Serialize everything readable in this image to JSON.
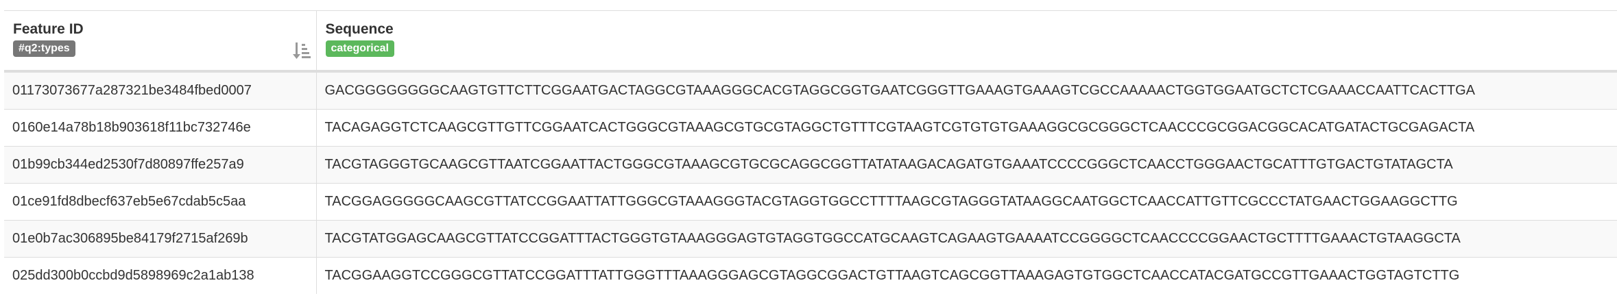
{
  "table": {
    "columns": [
      {
        "title": "Feature ID",
        "badge": "#q2:types",
        "badge_color": "#777777"
      },
      {
        "title": "Sequence",
        "badge": "categorical",
        "badge_color": "#5cb85c"
      }
    ],
    "sort_icon": "sort-amount-down-icon",
    "rows": [
      {
        "feature_id": "01173073677a287321be3484fbed0007",
        "sequence": "GACGGGGGGGGCAAGTGTTCTTCGGAATGACTAGGCGTAAAGGGCACGTAGGCGGTGAATCGGGTTGAAAGTGAAAGTCGCCAAAAACTGGTGGAATGCTCTCGAAACCAATTCACTTGA"
      },
      {
        "feature_id": "0160e14a78b18b903618f11bc732746e",
        "sequence": "TACAGAGGTCTCAAGCGTTGTTCGGAATCACTGGGCGTAAAGCGTGCGTAGGCTGTTTCGTAAGTCGTGTGTGAAAGGCGCGGGCTCAACCCGCGGACGGCACATGATACTGCGAGACTA"
      },
      {
        "feature_id": "01b99cb344ed2530f7d80897ffe257a9",
        "sequence": "TACGTAGGGTGCAAGCGTTAATCGGAATTACTGGGCGTAAAGCGTGCGCAGGCGGTTATATAAGACAGATGTGAAATCCCCGGGCTCAACCTGGGAACTGCATTTGTGACTGTATAGCTA"
      },
      {
        "feature_id": "01ce91fd8dbecf637eb5e67cdab5c5aa",
        "sequence": "TACGGAGGGGGCAAGCGTTATCCGGAATTATTGGGCGTAAAGGGTACGTAGGTGGCCTTTTAAGCGTAGGGTATAAGGCAATGGCTCAACCATTGTTCGCCCTATGAACTGGAAGGCTTG"
      },
      {
        "feature_id": "01e0b7ac306895be84179f2715af269b",
        "sequence": "TACGTATGGAGCAAGCGTTATCCGGATTTACTGGGTGTAAAGGGAGTGTAGGTGGCCATGCAAGTCAGAAGTGAAAATCCGGGGCTCAACCCCGGAACTGCTTTTGAAACTGTAAGGCTA"
      },
      {
        "feature_id": "025dd300b0ccbd9d5898969c2a1ab138",
        "sequence": "TACGGAAGGTCCGGGCGTTATCCGGATTTATTGGGTTTAAAGGGAGCGTAGGCGGACTGTTAAGTCAGCGGTTAAAGAGTGTGGCTCAACCATACGATGCCGTTGAAACTGGTAGTCTTG"
      }
    ]
  }
}
